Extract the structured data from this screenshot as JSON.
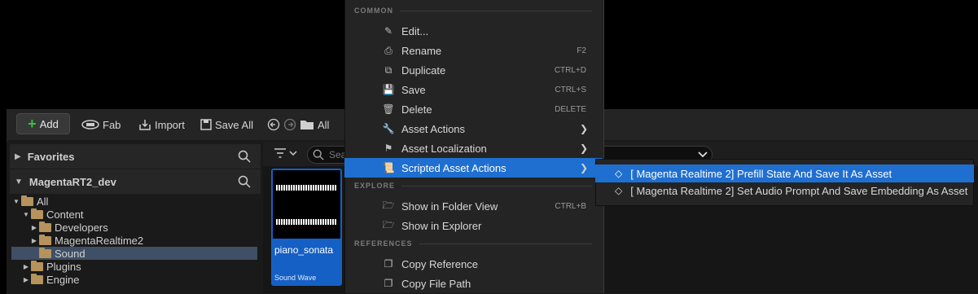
{
  "toolbar": {
    "add_label": "Add",
    "fab_label": "Fab",
    "import_label": "Import",
    "save_all_label": "Save All",
    "path_label": "All"
  },
  "sidebar": {
    "favorites": "Favorites",
    "project": "MagentaRT2_dev",
    "tree": [
      {
        "label": "All"
      },
      {
        "label": "Content"
      },
      {
        "label": "Developers"
      },
      {
        "label": "MagentaRealtime2"
      },
      {
        "label": "Sound"
      },
      {
        "label": "Plugins"
      },
      {
        "label": "Engine"
      }
    ]
  },
  "search": {
    "placeholder": "Sea"
  },
  "asset": {
    "name": "piano_sonata",
    "type": "Sound Wave"
  },
  "menu": {
    "sections": {
      "common": "COMMON",
      "explore": "EXPLORE",
      "references": "REFERENCES"
    },
    "items": [
      {
        "label": "Edit...",
        "shortcut": "",
        "icon": "pencil-icon"
      },
      {
        "label": "Rename",
        "shortcut": "F2",
        "icon": "rename-icon"
      },
      {
        "label": "Duplicate",
        "shortcut": "CTRL+D",
        "icon": "duplicate-icon"
      },
      {
        "label": "Save",
        "shortcut": "CTRL+S",
        "icon": "save-icon"
      },
      {
        "label": "Delete",
        "shortcut": "DELETE",
        "icon": "trash-icon"
      },
      {
        "label": "Asset Actions",
        "shortcut": "",
        "icon": "wrench-icon"
      },
      {
        "label": "Asset Localization",
        "shortcut": "",
        "icon": "flag-icon"
      },
      {
        "label": "Scripted Asset Actions",
        "shortcut": "",
        "icon": "script-icon"
      },
      {
        "label": "Show in Folder View",
        "shortcut": "CTRL+B",
        "icon": "folder-search-icon"
      },
      {
        "label": "Show in Explorer",
        "shortcut": "",
        "icon": "folder-search-icon"
      },
      {
        "label": "Copy Reference",
        "shortcut": "",
        "icon": "copy-icon"
      },
      {
        "label": "Copy File Path",
        "shortcut": "",
        "icon": "copy-icon"
      }
    ]
  },
  "submenu": {
    "items": [
      {
        "label": "[ Magenta Realtime 2] Prefill State And Save It As Asset"
      },
      {
        "label": "[ Magenta Realtime 2] Set Audio Prompt And  Save Embedding As Asset"
      }
    ]
  },
  "colors": {
    "accent": "#1f6fd0",
    "menu_bg": "#242424",
    "add_plus": "#36c13a",
    "folder": "#b6925d"
  }
}
